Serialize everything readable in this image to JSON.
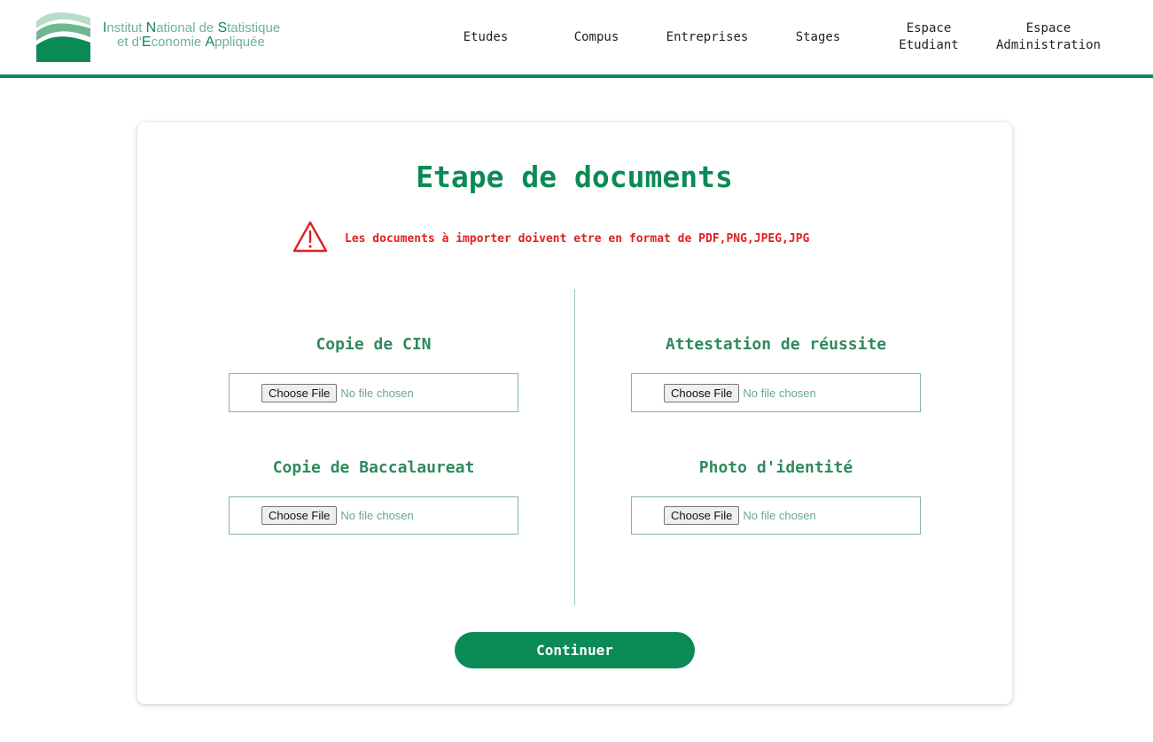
{
  "header": {
    "logo": {
      "line1": "Institut National de Statistique",
      "line2": "et d'Economie Appliquée"
    },
    "nav": [
      {
        "label": "Etudes"
      },
      {
        "label": "Compus"
      },
      {
        "label": "Entreprises"
      },
      {
        "label": "Stages"
      },
      {
        "label_line1": "Espace",
        "label_line2": "Etudiant"
      },
      {
        "label_line1": "Espace",
        "label_line2": "Administration"
      }
    ]
  },
  "main": {
    "title": "Etape de documents",
    "warning": "Les documents à importer doivent etre en format de PDF,PNG,JPEG,JPG",
    "fields": [
      {
        "label": "Copie de CIN",
        "button": "Choose File",
        "status": "No file chosen"
      },
      {
        "label": "Attestation de réussite",
        "button": "Choose File",
        "status": "No file chosen"
      },
      {
        "label": "Copie de Baccalaureat",
        "button": "Choose File",
        "status": "No file chosen"
      },
      {
        "label": "Photo d'identité",
        "button": "Choose File",
        "status": "No file chosen"
      }
    ],
    "continue_label": "Continuer"
  },
  "colors": {
    "brand_green": "#0a8a55",
    "warning_red": "#e02020"
  },
  "icons": [
    "logo-waves-icon",
    "warning-triangle-icon"
  ]
}
